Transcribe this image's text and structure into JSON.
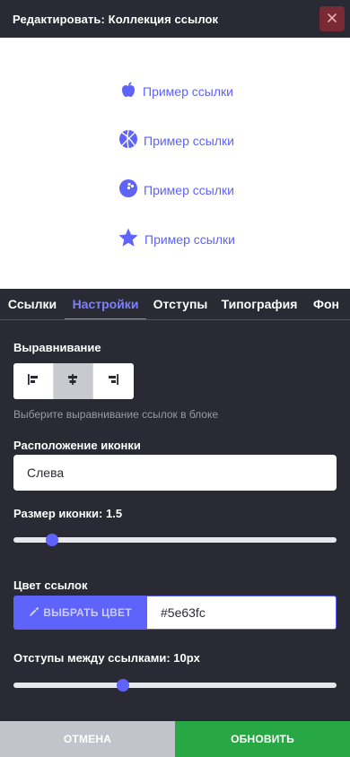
{
  "header": {
    "title": "Редактировать: Коллекция ссылок",
    "close_icon": "close-icon",
    "close_color": "#7a2a34"
  },
  "preview": {
    "links": [
      {
        "icon": "apple-icon",
        "label": "Пример ссылки"
      },
      {
        "icon": "basketball-icon",
        "label": "Пример ссылки"
      },
      {
        "icon": "bowling-ball-icon",
        "label": "Пример ссылки"
      },
      {
        "icon": "star-icon",
        "label": "Пример ссылки"
      }
    ],
    "link_color": "#5e63fc"
  },
  "tabs": [
    {
      "label": "Ссылки",
      "active": false
    },
    {
      "label": "Настройки",
      "active": true
    },
    {
      "label": "Отступы",
      "active": false
    },
    {
      "label": "Типография",
      "active": false
    },
    {
      "label": "Фон",
      "active": false
    }
  ],
  "settings": {
    "alignment": {
      "label": "Выравнивание",
      "options": [
        "align-left-icon",
        "align-center-icon",
        "align-right-icon"
      ],
      "selected": "center",
      "hint": "Выберите выравнивание ссылок в блоке"
    },
    "icon_position": {
      "label": "Расположение иконки",
      "value": "Слева"
    },
    "icon_size": {
      "label": "Размер иконки: 1.5",
      "value": 1.5,
      "fraction": 0.12
    },
    "link_color": {
      "label": "Цвет ссылок",
      "button_label": "ВЫБРАТЬ ЦВЕТ",
      "button_icon": "eyedropper-icon",
      "value": "#5e63fc"
    },
    "link_spacing": {
      "label": "Отступы между ссылками: 10px",
      "value": 10,
      "fraction": 0.34
    }
  },
  "footer": {
    "cancel_label": "ОТМЕНА",
    "update_label": "ОБНОВИТЬ",
    "update_color": "#27a844"
  }
}
